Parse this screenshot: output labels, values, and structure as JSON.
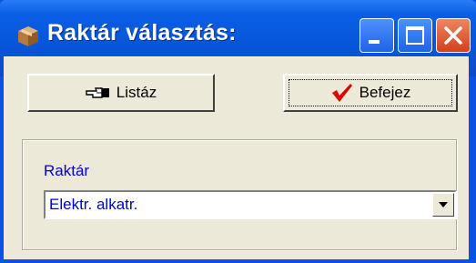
{
  "window": {
    "title": "Raktár választás:",
    "colors": {
      "titlebar": "#0755d9",
      "close": "#d4401c",
      "face": "#ece9d8",
      "field_text": "#0000cc"
    }
  },
  "toolbar": {
    "list_label": "Listáz",
    "list_icon": "pointing-hand-icon",
    "finish_label": "Befejez",
    "finish_icon": "checkmark-icon"
  },
  "form": {
    "warehouse_label": "Raktár",
    "warehouse_value": "Elektr. alkatr."
  }
}
